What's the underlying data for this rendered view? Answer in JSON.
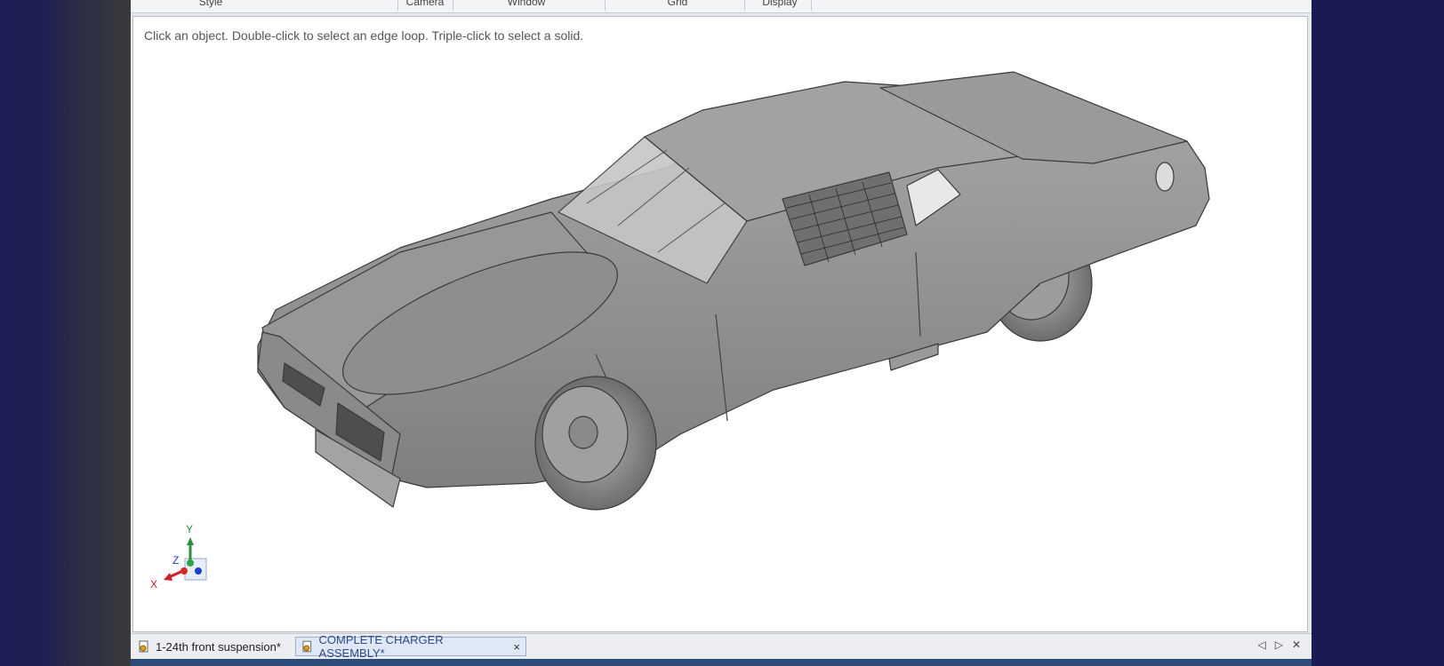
{
  "ribbon": {
    "groups": [
      "Style",
      "Camera",
      "Window",
      "Grid",
      "Display"
    ]
  },
  "viewport": {
    "hint": "Click an object. Double-click to select an edge loop. Triple-click to select a solid.",
    "model_color": "#8e8e8e",
    "triad": {
      "x_label": "X",
      "y_label": "Y",
      "z_label": "Z"
    }
  },
  "tabs": [
    {
      "label": "1-24th front suspension*",
      "active": false,
      "icon": "document-icon"
    },
    {
      "label": "COMPLETE CHARGER ASSEMBLY*",
      "active": true,
      "icon": "document-icon",
      "close": "×"
    }
  ],
  "tab_nav": {
    "prev": "◁",
    "next": "▷",
    "close": "✕"
  }
}
